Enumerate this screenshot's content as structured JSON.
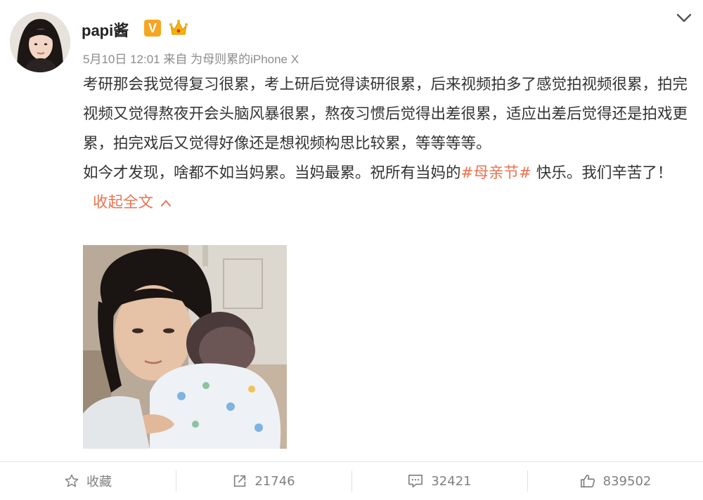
{
  "post": {
    "username": "papi酱",
    "verified_badge": "V",
    "meta": "5月10日 12:01 来自 为母则累的iPhone X",
    "paragraph1": "考研那会我觉得复习很累，考上研后觉得读研很累，后来视频拍多了感觉拍视频很累，拍完视频又觉得熬夜开会头脑风暴很累，熬夜习惯后觉得出差很累，适应出差后觉得还是拍戏更累，拍完戏后又觉得好像还是想视频构思比较累，等等等等。",
    "paragraph2_before": "如今才发现，啥都不如当妈累。当妈最累。祝所有当妈的",
    "hashtag": "#母亲节#",
    "paragraph2_after": " 快乐。我们辛苦了！",
    "collapse_label": "收起全文",
    "collapse_icon": "chevron-up-icon",
    "expand_menu_icon": "chevron-down-icon"
  },
  "actions": {
    "favorite_label": "收藏",
    "repost_count": "21746",
    "comment_count": "32421",
    "like_count": "839502"
  },
  "colors": {
    "link": "#eb7350",
    "meta_text": "#8c8c8c",
    "badge": "#f6a623"
  }
}
